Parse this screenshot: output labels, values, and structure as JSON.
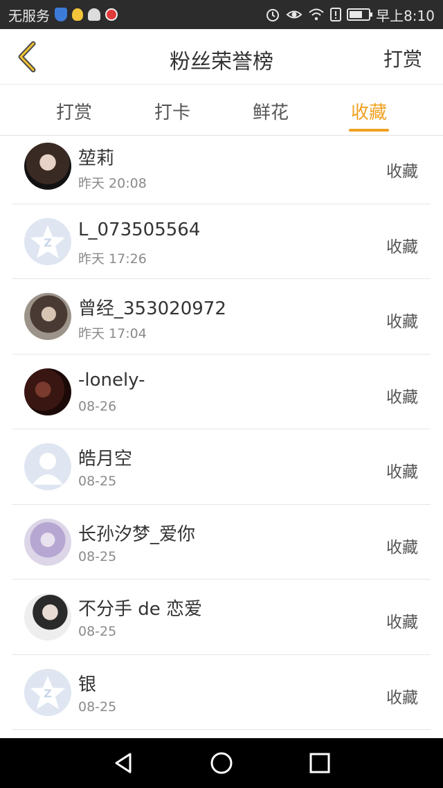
{
  "status_bar": {
    "carrier": "无服务",
    "time": "早上8:10"
  },
  "header": {
    "title": "粉丝荣誉榜",
    "right_action": "打赏"
  },
  "tabs": [
    {
      "label": "打赏",
      "active": false
    },
    {
      "label": "打卡",
      "active": false
    },
    {
      "label": "鲜花",
      "active": false
    },
    {
      "label": "收藏",
      "active": true
    }
  ],
  "colors": {
    "accent": "#f0a020",
    "status_bar": "#2c2c2c"
  },
  "fans": [
    {
      "name": "堃莉",
      "time": "昨天 20:08",
      "action": "收藏",
      "avatar": "photo-avatar"
    },
    {
      "name": "L_073505564",
      "time": "昨天 17:26",
      "action": "收藏",
      "avatar": "default-qq-avatar"
    },
    {
      "name": "曾经_353020972",
      "time": "昨天 17:04",
      "action": "收藏",
      "avatar": "photo-avatar"
    },
    {
      "name": "-lonely-",
      "time": "08-26",
      "action": "收藏",
      "avatar": "photo-avatar"
    },
    {
      "name": "皓月空",
      "time": "08-25",
      "action": "收藏",
      "avatar": "default-person-avatar"
    },
    {
      "name": "长孙汐梦_爱你",
      "time": "08-25",
      "action": "收藏",
      "avatar": "photo-avatar"
    },
    {
      "name": "不分手 de 恋爱",
      "time": "08-25",
      "action": "收藏",
      "avatar": "photo-avatar"
    },
    {
      "name": "银",
      "time": "08-25",
      "action": "收藏",
      "avatar": "default-qq-avatar"
    }
  ]
}
